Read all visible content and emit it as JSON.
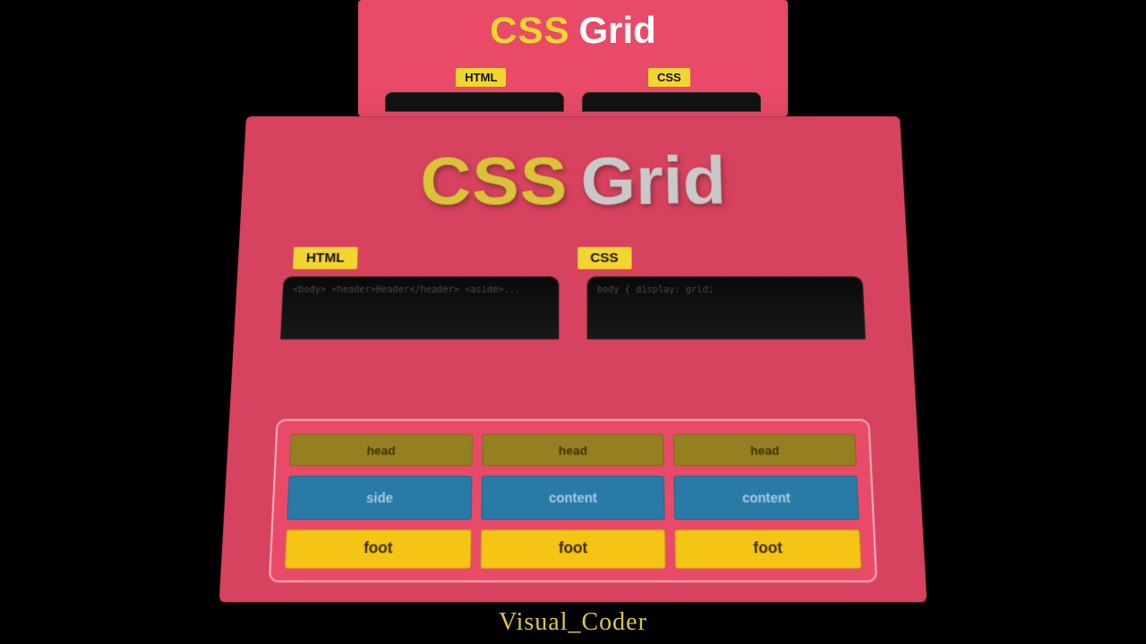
{
  "title": {
    "part1": "CSS",
    "part2": "Grid"
  },
  "tags": {
    "html": "HTML",
    "css": "CSS"
  },
  "code": {
    "html_snippet": "<body>\n  <header>Header</header>  <aside>...",
    "css_snippet": "body {\n  display: grid;"
  },
  "grid": {
    "head": "head",
    "side": "side",
    "content": "content",
    "foot": "foot"
  },
  "watermark": "Visual_Coder"
}
